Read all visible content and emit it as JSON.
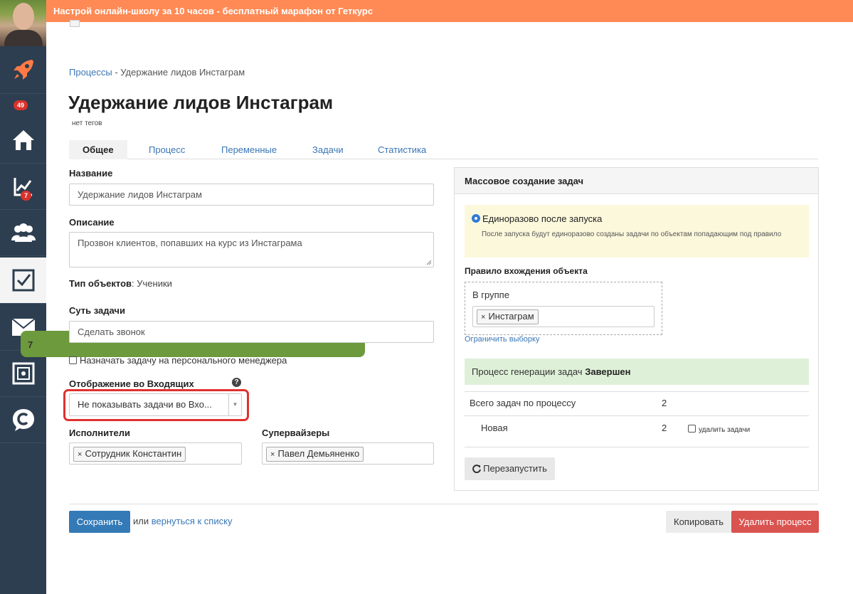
{
  "banner": {
    "text": "Настрой онлайн-школу за 10 часов - бесплатный марафон от Геткурс"
  },
  "sidebar": {
    "notification_count": "49",
    "items": [
      {
        "icon": "rocket-icon"
      },
      {
        "icon": "home-icon"
      },
      {
        "icon": "chart-icon",
        "badge": "7"
      },
      {
        "icon": "users-icon"
      },
      {
        "icon": "checkbox-icon"
      },
      {
        "icon": "mail-icon",
        "badge": "7"
      },
      {
        "icon": "safe-icon"
      },
      {
        "icon": "chat-logo-icon"
      }
    ]
  },
  "breadcrumb": {
    "parent": "Процессы",
    "separator": "-",
    "current": "Удержание лидов Инстаграм"
  },
  "page": {
    "title": "Удержание лидов Инстаграм",
    "tags": "нет тегов"
  },
  "tabs": [
    "Общее",
    "Процесс",
    "Переменные",
    "Задачи",
    "Статистика"
  ],
  "form": {
    "name_label": "Название",
    "name_value": "Удержание лидов Инстаграм",
    "description_label": "Описание",
    "description_value": "Прозвон клиентов, попавших на курс из Инстаграма",
    "object_type_label": "Тип объектов",
    "object_type_value": ": Ученики",
    "task_essence_label": "Суть задачи",
    "task_essence_value": "Сделать звонок",
    "personal_manager_label": "Назначать задачу на персонального менеджера",
    "inbox_display_label": "Отображение во Входящих",
    "inbox_display_value": "Не показывать задачи во Вхо...",
    "help": "?",
    "executors_label": "Исполнители",
    "executor_token": "Сотрудник Константин",
    "supervisors_label": "Супервайзеры",
    "supervisor_token": "Павел Демьяненко",
    "token_remove": "×"
  },
  "panel": {
    "title": "Массовое создание задач",
    "radio_label": "Единоразово после запуска",
    "radio_hint": "После запуска будут единоразово созданы задачи по объектам попадающим под правило",
    "rule_label": "Правило вхождения объекта",
    "group_label": "В группе",
    "group_token": "Инстаграм",
    "limit_link": "Ограничить выборку",
    "status_text": "Процесс генерации задач",
    "status_value": "Завершен",
    "total_label": "Всего задач по процессу",
    "total_value": "2",
    "new_label": "Новая",
    "new_value": "2",
    "delete_tasks_label": "удалить задачи",
    "restart_button": "Перезапустить"
  },
  "footer": {
    "save_button": "Сохранить",
    "or_text": "или",
    "back_link": "вернуться к списку",
    "copy_button": "Копировать",
    "delete_button": "Удалить процесс"
  }
}
